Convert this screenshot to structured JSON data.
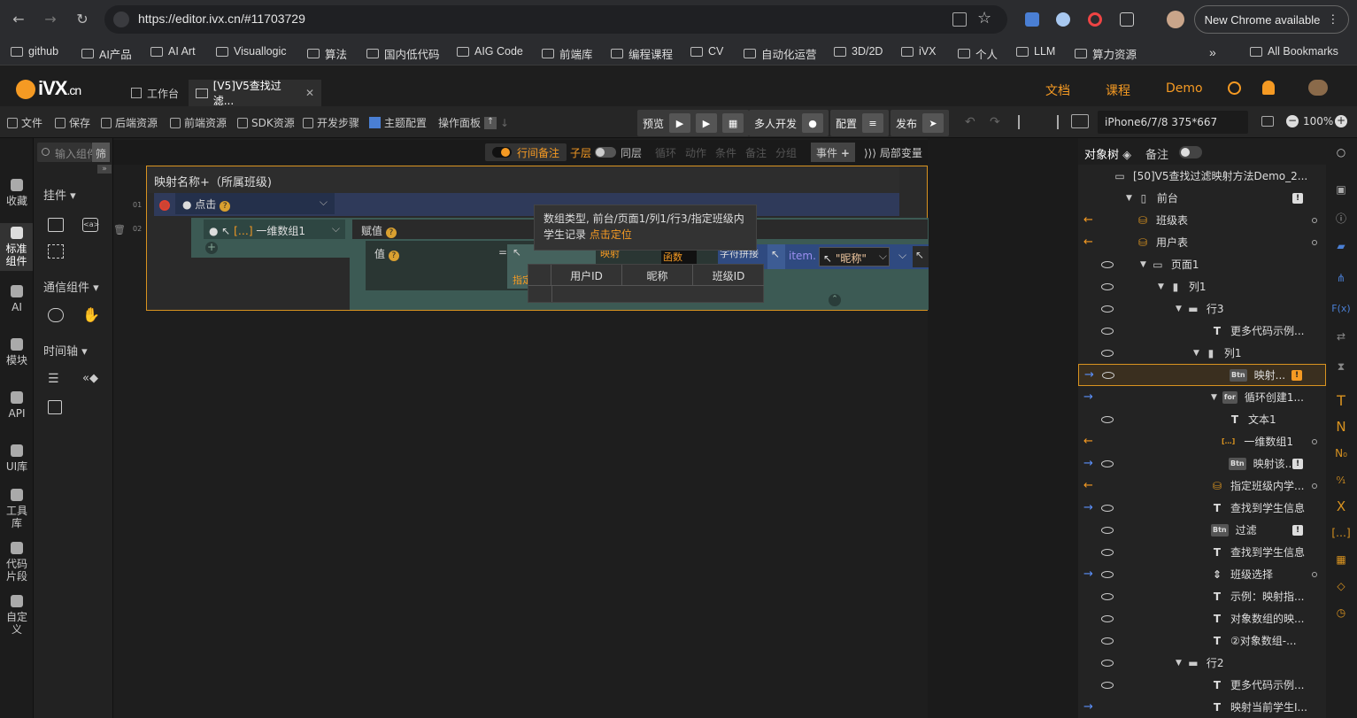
{
  "browser": {
    "url": "https://editor.ivx.cn/#11703729",
    "new_chrome": "New Chrome available",
    "bookmarks": [
      "github",
      "AI产品",
      "AI Art",
      "Visuallogic",
      "算法",
      "国内低代码",
      "AIG Code",
      "前端库",
      "编程课程",
      "CV",
      "自动化运营",
      "3D/2D",
      "iVX",
      "个人",
      "LLM",
      "算力资源"
    ],
    "all_bookmarks": "All Bookmarks",
    "overflow": "»"
  },
  "app": {
    "logo_main": "iVX",
    "logo_suffix": ".cn",
    "tab_workbench": "工作台",
    "tab_project": "[V5]V5查找过滤...",
    "links": [
      "文档",
      "课程",
      "Demo"
    ]
  },
  "toolbar": {
    "file": "文件",
    "save": "保存",
    "backend": "后端资源",
    "frontend": "前端资源",
    "sdk": "SDK资源",
    "steps": "开发步骤",
    "theme": "主题配置",
    "op_panel": "操作面板",
    "preview": "预览",
    "multi_dev": "多人开发",
    "config": "配置",
    "publish": "发布",
    "device": "iPhone6/7/8 375*667",
    "zoom": "100%",
    "accent": "#f59a23"
  },
  "left_rail": [
    "收藏",
    "标准组件",
    "AI",
    "模块",
    "API",
    "UI库",
    "工具库",
    "代码片段",
    "自定义"
  ],
  "comp_panel": {
    "search_placeholder": "输入组件名称",
    "filter": "筛",
    "sections": [
      "挂件",
      "通信组件",
      "时间轴"
    ]
  },
  "canvas_bar": {
    "line_note": "行间备注",
    "child": "子层",
    "same": "同层",
    "loop": "循环",
    "action": "动作",
    "cond": "条件",
    "note": "备注",
    "group": "分组",
    "event": "事件",
    "local_var": "局部变量"
  },
  "block": {
    "title": "映射名称+（所属班级)",
    "line1": "01",
    "line2": "02",
    "event": "点击",
    "array": "一维数组1",
    "assign": "赋值",
    "value": "值",
    "equals": "=",
    "tooltip_l1": "数组类型, 前台/页面1/列1/行3/指定班级内",
    "tooltip_l2": "学生记录",
    "tooltip_link": "点击定位",
    "partial_text": "指定班级内学生记录",
    "map_text": "映射",
    "func_text": "函数",
    "str_text": "字符拼接",
    "item_text": "item.",
    "nickname": "\"昵称\"",
    "cols": [
      "用户ID",
      "昵称",
      "班级ID"
    ]
  },
  "right_panel": {
    "tab_tree": "对象树",
    "tab_note": "备注",
    "rows": [
      {
        "label": "[50]V5查找过滤映射方法Demo_2...",
        "icon": "page",
        "arrow": "",
        "eye": false
      },
      {
        "label": "前台",
        "icon": "phone",
        "arrow": "",
        "eye": false
      },
      {
        "label": "班级表",
        "icon": "db",
        "arrow": "left",
        "eye": false
      },
      {
        "label": "用户表",
        "icon": "db",
        "arrow": "left",
        "eye": false
      },
      {
        "label": "页面1",
        "icon": "page",
        "arrow": "",
        "eye": true
      },
      {
        "label": "列1",
        "icon": "col",
        "arrow": "",
        "eye": true
      },
      {
        "label": "行3",
        "icon": "row",
        "arrow": "",
        "eye": true
      },
      {
        "label": "更多代码示例...",
        "icon": "T",
        "arrow": "",
        "eye": true
      },
      {
        "label": "列1",
        "icon": "col",
        "arrow": "",
        "eye": true
      },
      {
        "label": "映射...",
        "icon": "Btn",
        "arrow": "right",
        "eye": true
      },
      {
        "label": "循环创建1...",
        "icon": "for",
        "arrow": "right",
        "eye": false
      },
      {
        "label": "文本1",
        "icon": "T",
        "arrow": "",
        "eye": true
      },
      {
        "label": "一维数组1",
        "icon": "arr",
        "arrow": "left",
        "eye": false
      },
      {
        "label": "映射该...",
        "icon": "Btn",
        "arrow": "right",
        "eye": true
      },
      {
        "label": "指定班级内学...",
        "icon": "db",
        "arrow": "left",
        "eye": false
      },
      {
        "label": "查找到学生信息",
        "icon": "T",
        "arrow": "right",
        "eye": true
      },
      {
        "label": "过滤",
        "icon": "Btn",
        "arrow": "",
        "eye": true
      },
      {
        "label": "查找到学生信息",
        "icon": "T",
        "arrow": "",
        "eye": true
      },
      {
        "label": "班级选择",
        "icon": "sel",
        "arrow": "right",
        "eye": true
      },
      {
        "label": "示例：映射指...",
        "icon": "T",
        "arrow": "",
        "eye": true
      },
      {
        "label": "对象数组的映...",
        "icon": "T",
        "arrow": "",
        "eye": true
      },
      {
        "label": "②对象数组-...",
        "icon": "T",
        "arrow": "",
        "eye": true
      },
      {
        "label": "行2",
        "icon": "row",
        "arrow": "",
        "eye": true
      },
      {
        "label": "更多代码示例...",
        "icon": "T",
        "arrow": "",
        "eye": true
      },
      {
        "label": "映射当前学生I...",
        "icon": "T",
        "arrow": "right",
        "eye": false
      }
    ]
  },
  "right_rail": [
    "T",
    "N",
    "N₀",
    "⁰⁄₁",
    "X"
  ]
}
